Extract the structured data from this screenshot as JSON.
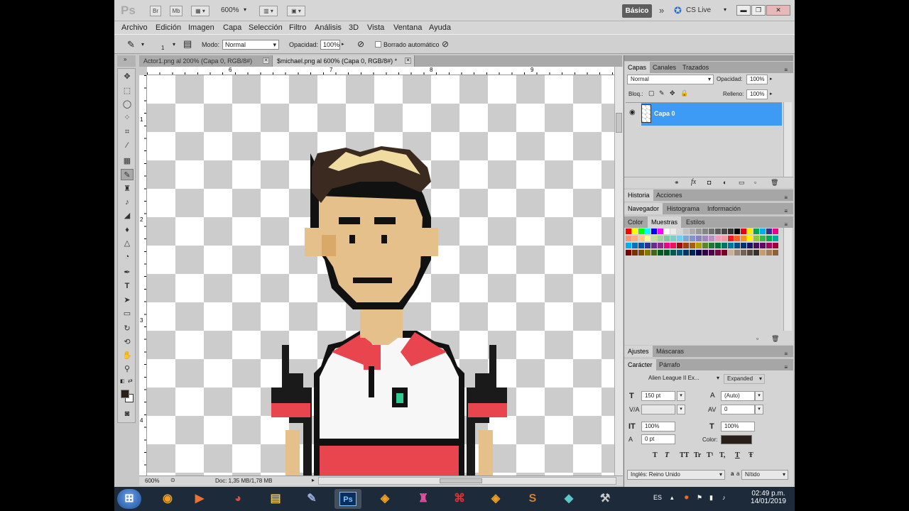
{
  "titlebar": {
    "logo": "Ps",
    "btn_br": "Br",
    "btn_mb": "Mb",
    "zoom": "600%",
    "workspace": "Básico",
    "cslive": "CS Live"
  },
  "menu": [
    "Archivo",
    "Edición",
    "Imagen",
    "Capa",
    "Selección",
    "Filtro",
    "Análisis",
    "3D",
    "Vista",
    "Ventana",
    "Ayuda"
  ],
  "options": {
    "brush_size": "1",
    "mode_label": "Modo:",
    "mode_value": "Normal",
    "opacity_label": "Opacidad:",
    "opacity_value": "100%",
    "auto_erase": "Borrado automático"
  },
  "doc_tabs": [
    {
      "label": "Actor1.png al 200% (Capa 0, RGB/8#)",
      "active": false
    },
    {
      "label": "$michael.png al 600% (Capa 0, RGB/8#) *",
      "active": true
    }
  ],
  "rulers": {
    "h": [
      "6",
      "7",
      "8",
      "9"
    ],
    "v": [
      "1",
      "2",
      "3",
      "4"
    ]
  },
  "status": {
    "zoom": "600%",
    "doc": "Doc: 1,35 MB/1,78 MB"
  },
  "layers_panel": {
    "tabs": [
      "Capas",
      "Canales",
      "Trazados"
    ],
    "blend": "Normal",
    "opacity_label": "Opacidad:",
    "opacity": "100%",
    "lock_label": "Bloq.:",
    "fill_label": "Relleno:",
    "fill": "100%",
    "layer_name": "Capa 0"
  },
  "history_tabs": [
    "Historia",
    "Acciones"
  ],
  "nav_tabs": [
    "Navegador",
    "Histograma",
    "Información"
  ],
  "swatch_tabs": [
    "Color",
    "Muestras",
    "Estilos"
  ],
  "adjust_tabs": [
    "Ajustes",
    "Máscaras"
  ],
  "char_panel": {
    "tabs": [
      "Carácter",
      "Párrafo"
    ],
    "font": "Alien League II Ex...",
    "style": "Expanded",
    "size": "150 pt",
    "leading": "(Auto)",
    "tracking": "0",
    "v_scale": "100%",
    "h_scale": "100%",
    "baseline": "0 pt",
    "color_label": "Color:",
    "language": "Inglés: Reino Unido",
    "aa_label": "a",
    "aa": "Nítido",
    "type_buttons": [
      "T",
      "T",
      "TT",
      "Tr",
      "T¹",
      "T,",
      "T",
      "Ŧ"
    ]
  },
  "taskbar": {
    "lang": "ES",
    "time": "02:49 p.m.",
    "date": "14/01/2019",
    "ps_label": "Ps"
  },
  "colors": {
    "accent": "#3d9af5",
    "foreground": "#2a1f18",
    "background": "#ffffff"
  }
}
